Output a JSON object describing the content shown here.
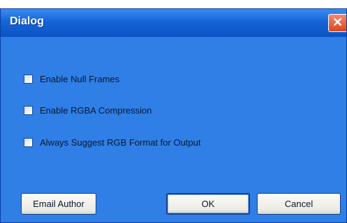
{
  "window": {
    "title": "Dialog",
    "close_glyph": "✕"
  },
  "options": [
    {
      "label": "Enable Null Frames",
      "checked": false
    },
    {
      "label": "Enable RGBA Compression",
      "checked": false
    },
    {
      "label": "Always Suggest RGB Format for Output",
      "checked": false
    }
  ],
  "buttons": {
    "email_author": "Email Author",
    "ok": "OK",
    "cancel": "Cancel"
  },
  "colors": {
    "dialog_background": "#2f7fe6",
    "titlebar": "#0b52c4",
    "close_button": "#d9461f"
  }
}
